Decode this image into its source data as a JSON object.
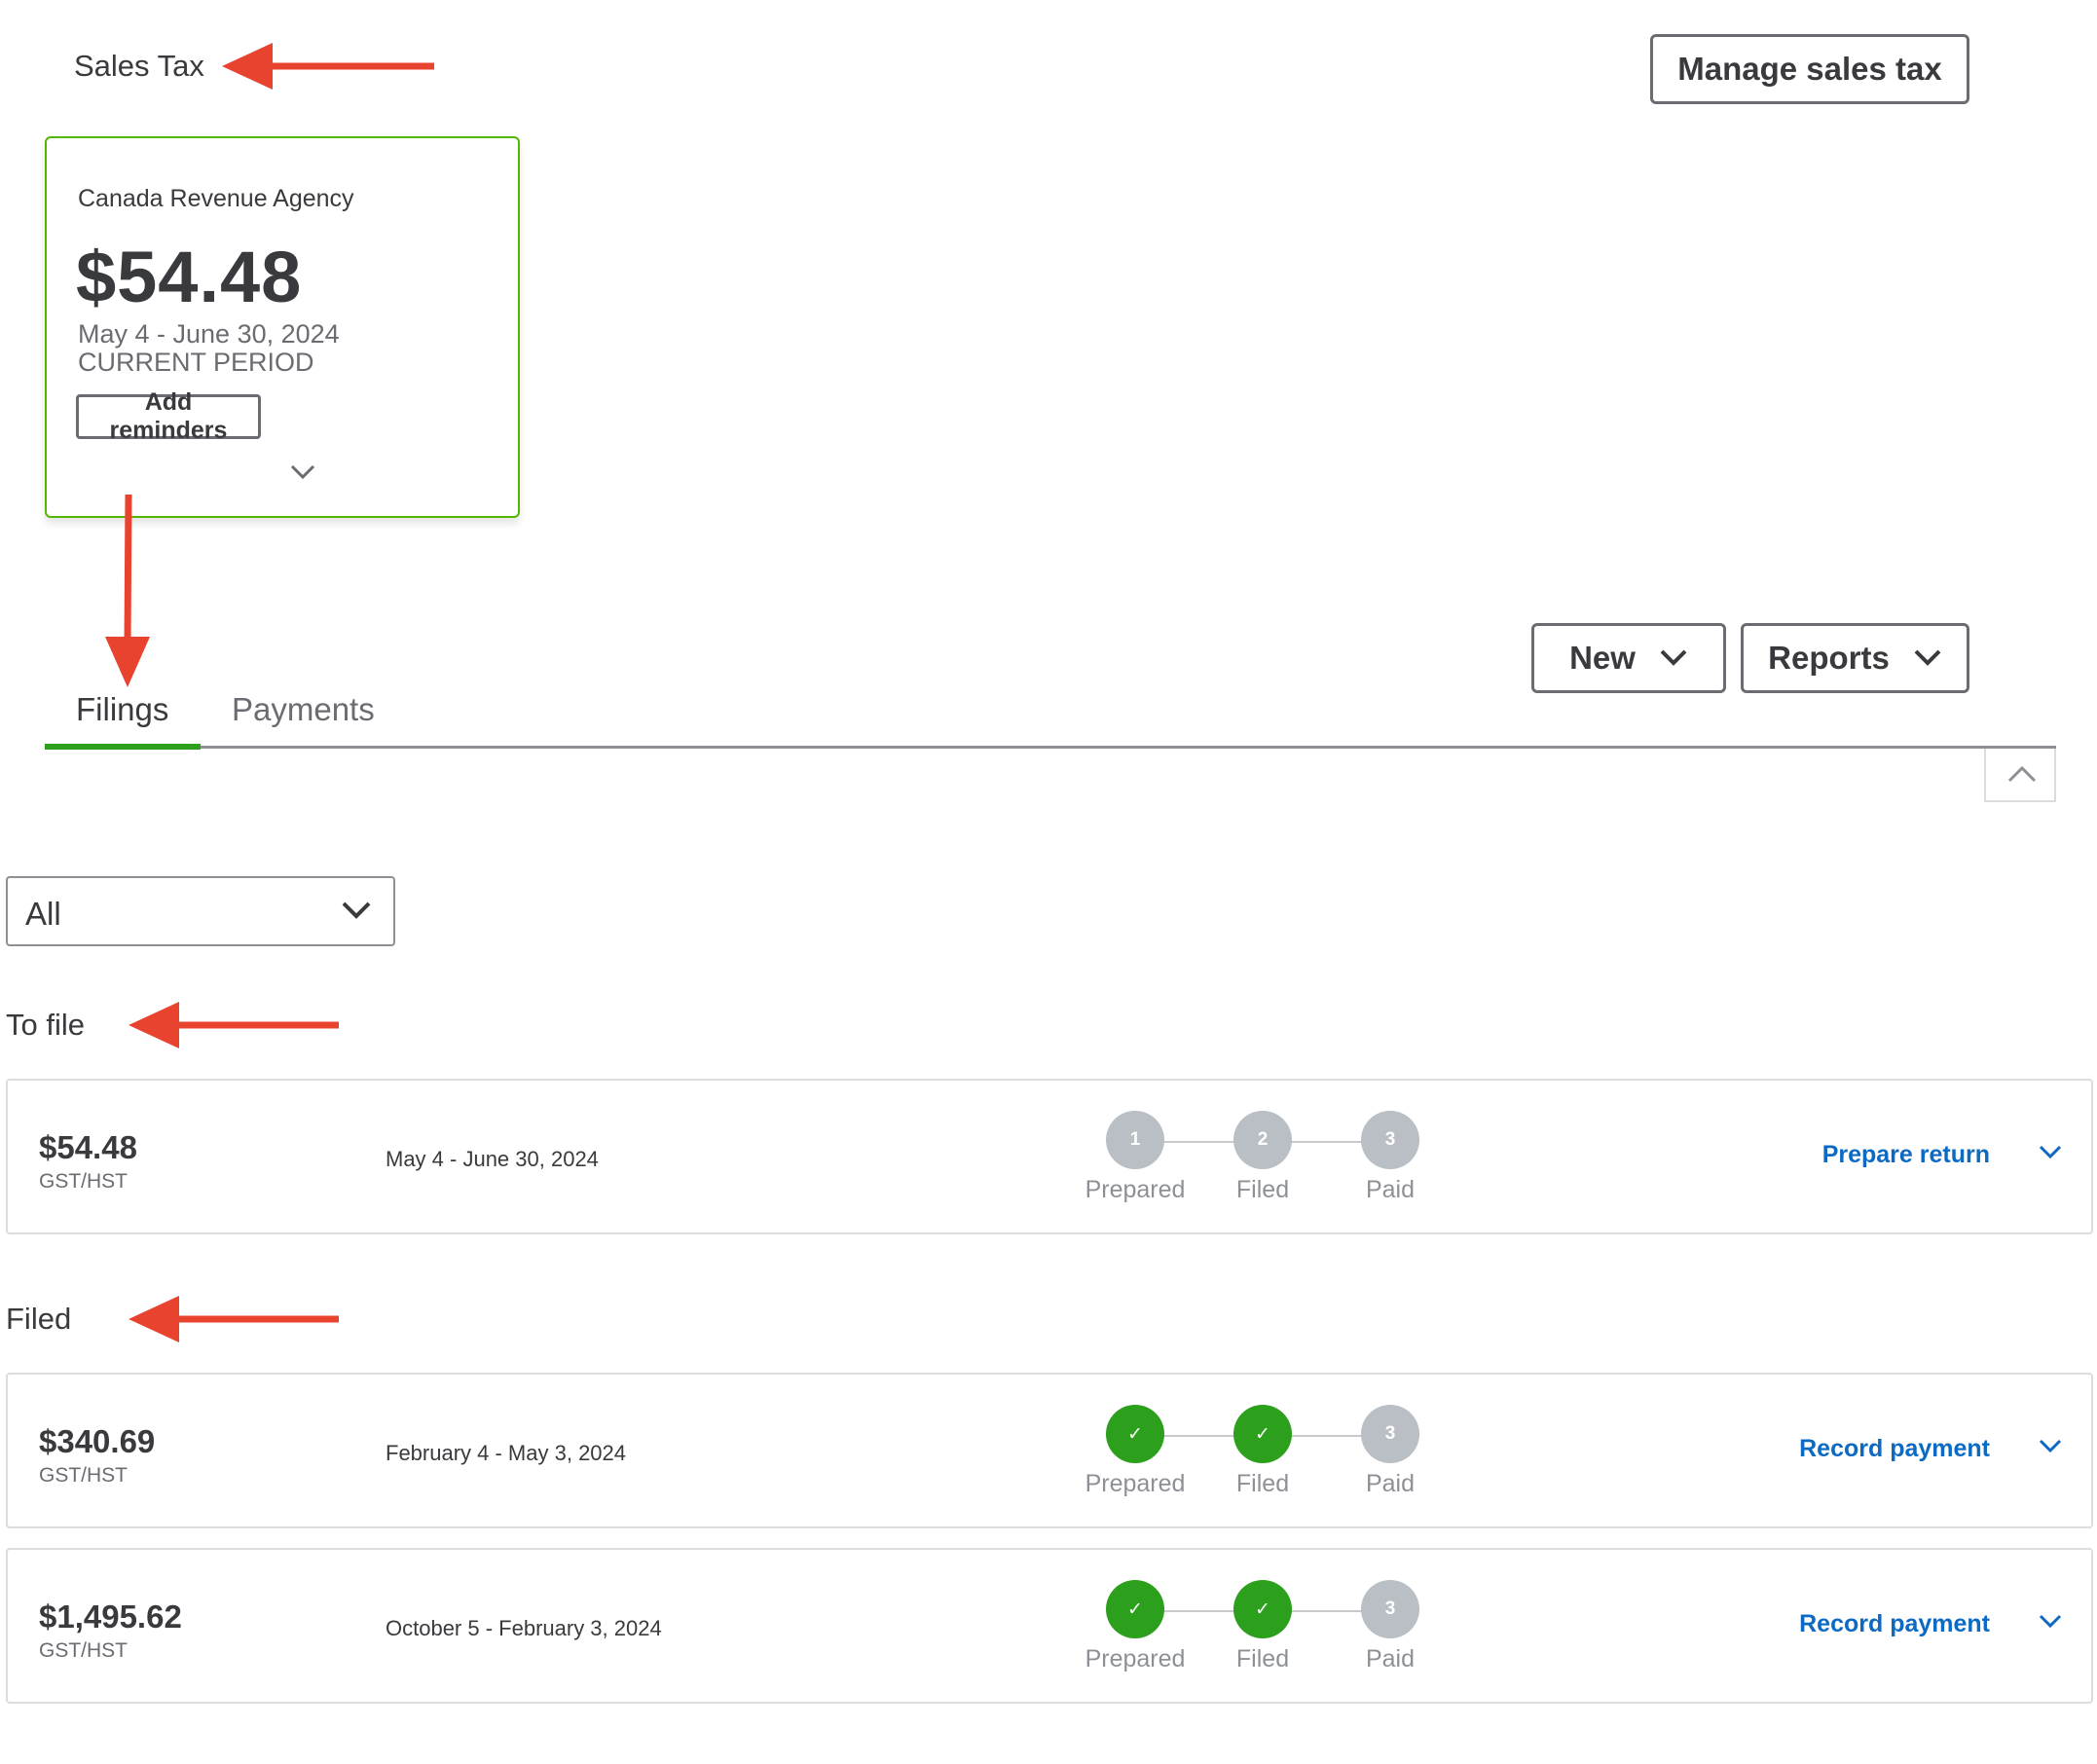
{
  "header": {
    "title": "Sales Tax",
    "manage_button": "Manage sales tax"
  },
  "agency_card": {
    "agency": "Canada Revenue Agency",
    "amount": "$54.48",
    "period": "May 4 - June 30, 2024",
    "status": "CURRENT PERIOD",
    "reminders_button": "Add reminders"
  },
  "tabs": [
    {
      "label": "Filings",
      "active": true
    },
    {
      "label": "Payments",
      "active": false
    }
  ],
  "toolbar": {
    "new_button": "New",
    "reports_button": "Reports"
  },
  "filter": {
    "value": "All"
  },
  "sections": {
    "to_file": "To file",
    "filed": "Filed"
  },
  "steps": [
    "Prepared",
    "Filed",
    "Paid"
  ],
  "filings": [
    {
      "amount": "$54.48",
      "type": "GST/HST",
      "period": "May 4 - June 30, 2024",
      "step_states": [
        "1",
        "2",
        "3"
      ],
      "completed": [
        false,
        false,
        false
      ],
      "action": "Prepare return"
    },
    {
      "amount": "$340.69",
      "type": "GST/HST",
      "period": "February 4 - May 3, 2024",
      "step_states": [
        "✓",
        "✓",
        "3"
      ],
      "completed": [
        true,
        true,
        false
      ],
      "action": "Record payment"
    },
    {
      "amount": "$1,495.62",
      "type": "GST/HST",
      "period": "October 5 - February 3, 2024",
      "step_states": [
        "✓",
        "✓",
        "3"
      ],
      "completed": [
        true,
        true,
        false
      ],
      "action": "Record payment"
    }
  ],
  "colors": {
    "accent_green": "#2ca01c",
    "link_blue": "#0d6ac2",
    "annotation_red": "#e8432e",
    "card_border_green": "#53b700"
  }
}
